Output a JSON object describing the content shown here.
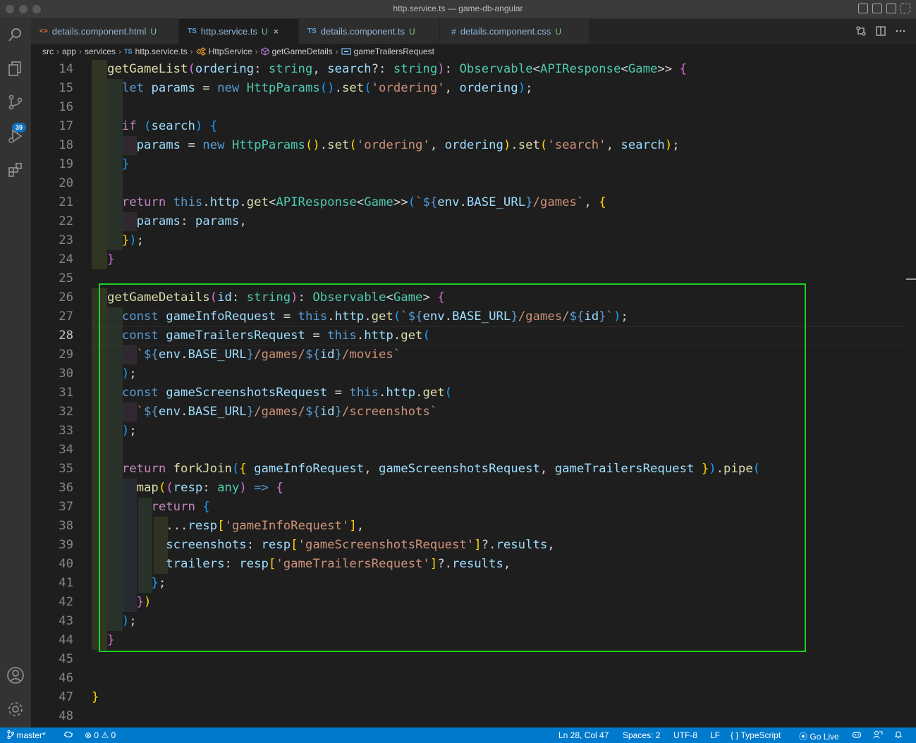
{
  "window": {
    "title": "http.service.ts — game-db-angular"
  },
  "activity_bar": {
    "source_control_badge": "39"
  },
  "tabs": [
    {
      "icon": "<>",
      "label": "details.component.html",
      "status": "U"
    },
    {
      "icon": "TS",
      "label": "http.service.ts",
      "status": "U",
      "close": "×"
    },
    {
      "icon": "TS",
      "label": "details.component.ts",
      "status": "U"
    },
    {
      "icon": "#",
      "label": "details.component.css",
      "status": "U"
    }
  ],
  "breadcrumbs": [
    "src",
    "app",
    "services",
    "http.service.ts",
    "HttpService",
    "getGameDetails",
    "gameTrailersRequest"
  ],
  "breadcrumb_icons": {
    "file": "TS"
  },
  "editor": {
    "current_line": 28,
    "line_numbers": [
      "14",
      "15",
      "16",
      "17",
      "18",
      "19",
      "20",
      "21",
      "22",
      "23",
      "24",
      "25",
      "26",
      "27",
      "28",
      "29",
      "30",
      "31",
      "32",
      "33",
      "34",
      "35",
      "36",
      "37",
      "38",
      "39",
      "40",
      "41",
      "42",
      "43",
      "44",
      "45",
      "46",
      "47",
      "48"
    ]
  },
  "status_bar": {
    "branch": "master*",
    "errors": "0",
    "warnings": "0",
    "position": "Ln 28, Col 47",
    "spaces": "Spaces: 2",
    "encoding": "UTF-8",
    "eol": "LF",
    "language": "TypeScript",
    "language_icon": "{ }",
    "go_live": "Go Live"
  },
  "colors": {
    "highlight_box": "#1fd21f",
    "status_bar": "#007acc"
  }
}
